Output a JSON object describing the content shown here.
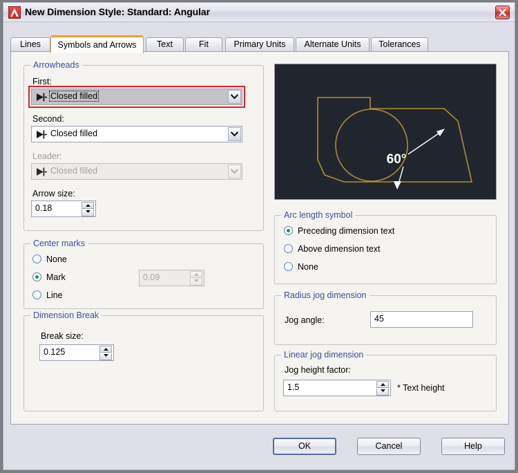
{
  "window": {
    "title": "New Dimension Style: Standard: Angular",
    "app_icon": "autocad-a-icon",
    "close_icon": "close-icon"
  },
  "tabs": [
    {
      "label": "Lines",
      "active": false
    },
    {
      "label": "Symbols and Arrows",
      "active": true
    },
    {
      "label": "Text",
      "active": false
    },
    {
      "label": "Fit",
      "active": false
    },
    {
      "label": "Primary Units",
      "active": false
    },
    {
      "label": "Alternate Units",
      "active": false
    },
    {
      "label": "Tolerances",
      "active": false
    }
  ],
  "arrowheads": {
    "group_label": "Arrowheads",
    "first_label": "First:",
    "first_value": "Closed filled",
    "second_label": "Second:",
    "second_value": "Closed filled",
    "leader_label": "Leader:",
    "leader_value": "Closed filled",
    "arrow_size_label": "Arrow size:",
    "arrow_size_value": "0.18"
  },
  "center_marks": {
    "group_label": "Center marks",
    "options": [
      "None",
      "Mark",
      "Line"
    ],
    "selected": "Mark",
    "size_value": "0.09"
  },
  "dimension_break": {
    "group_label": "Dimension Break",
    "break_size_label": "Break size:",
    "break_size_value": "0.125"
  },
  "arc_length_symbol": {
    "group_label": "Arc length symbol",
    "options": [
      "Preceding dimension text",
      "Above dimension text",
      "None"
    ],
    "selected": "Preceding dimension text"
  },
  "radius_jog": {
    "group_label": "Radius jog dimension",
    "jog_angle_label": "Jog angle:",
    "jog_angle_value": "45"
  },
  "linear_jog": {
    "group_label": "Linear jog dimension",
    "jog_height_label": "Jog height factor:",
    "jog_height_value": "1.5",
    "suffix": "* Text height"
  },
  "preview": {
    "angle_label": "60°",
    "background_color": "#21262e",
    "geometry_color": "#b08d32",
    "dimension_color": "#ffffff"
  },
  "buttons": {
    "ok": "OK",
    "cancel": "Cancel",
    "help": "Help"
  },
  "colors": {
    "group_title": "#3b4fa0",
    "accent_tab": "#f1a22a",
    "highlight_outline": "#ee1c22",
    "radio_dot": "#1f9b2f"
  }
}
